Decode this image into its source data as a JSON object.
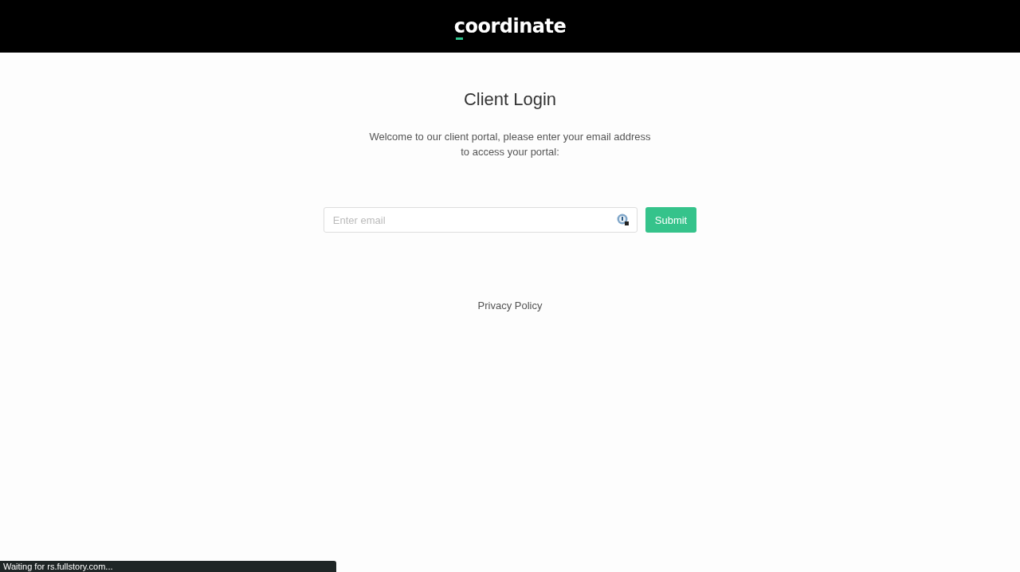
{
  "header": {
    "logo": "coordinate"
  },
  "title": "Client Login",
  "intro": [
    "Welcome to our client portal, please enter your email address",
    "to access your portal:"
  ],
  "email_field": {
    "placeholder": "Enter email"
  },
  "submit_button": "Submit",
  "footer_link": "Privacy Policy",
  "status_bar": "Waiting for rs.fullstory.com..."
}
